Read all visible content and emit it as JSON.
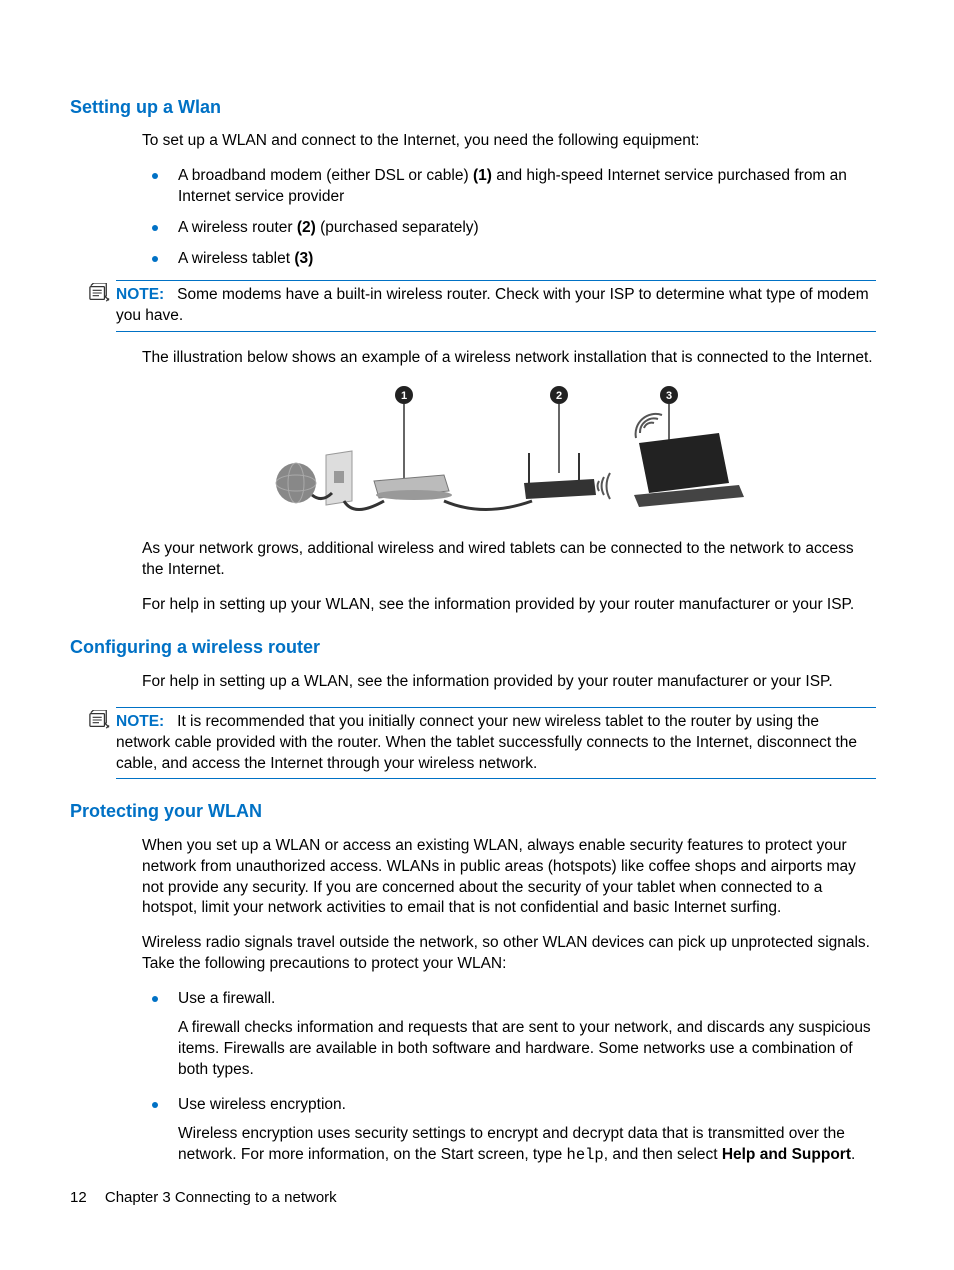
{
  "sections": {
    "wlan_setup": {
      "heading": "Setting up a Wlan",
      "intro": "To set up a WLAN and connect to the Internet, you need the following equipment:",
      "items": [
        {
          "pre": "A broadband modem (either DSL or cable) ",
          "bold": "(1)",
          "post": " and high-speed Internet service purchased from an Internet service provider"
        },
        {
          "pre": "A wireless router ",
          "bold": "(2)",
          "post": " (purchased separately)"
        },
        {
          "pre": "A wireless tablet ",
          "bold": "(3)",
          "post": ""
        }
      ],
      "note": {
        "label": "NOTE:",
        "text": "Some modems have a built-in wireless router. Check with your ISP to determine what type of modem you have."
      },
      "p2": "The illustration below shows an example of a wireless network installation that is connected to the Internet.",
      "p3": "As your network grows, additional wireless and wired tablets can be connected to the network to access the Internet.",
      "p4": "For help in setting up your WLAN, see the information provided by your router manufacturer or your ISP."
    },
    "config_router": {
      "heading": "Configuring a wireless router",
      "p1": "For help in setting up a WLAN, see the information provided by your router manufacturer or your ISP.",
      "note": {
        "label": "NOTE:",
        "text": "It is recommended that you initially connect your new wireless tablet to the router by using the network cable provided with the router. When the tablet successfully connects to the Internet, disconnect the cable, and access the Internet through your wireless network."
      }
    },
    "protect_wlan": {
      "heading": "Protecting your WLAN",
      "p1": "When you set up a WLAN or access an existing WLAN, always enable security features to protect your network from unauthorized access. WLANs in public areas (hotspots) like coffee shops and airports may not provide any security. If you are concerned about the security of your tablet when connected to a hotspot, limit your network activities to email that is not confidential and basic Internet surfing.",
      "p2": "Wireless radio signals travel outside the network, so other WLAN devices can pick up unprotected signals. Take the following precautions to protect your WLAN:",
      "items": [
        {
          "title": "Use a firewall.",
          "desc": "A firewall checks information and requests that are sent to your network, and discards any suspicious items. Firewalls are available in both software and hardware. Some networks use a combination of both types."
        },
        {
          "title": "Use wireless encryption.",
          "desc_pre": "Wireless encryption uses security settings to encrypt and decrypt data that is transmitted over the network. For more information, on the Start screen, type ",
          "mono": "help",
          "desc_mid": ", and then select ",
          "bold": "Help and Support",
          "desc_post": "."
        }
      ]
    }
  },
  "footer": {
    "page_number": "12",
    "chapter": "Chapter 3   Connecting to a network"
  }
}
